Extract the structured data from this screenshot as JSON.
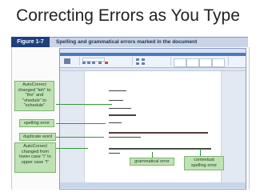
{
  "slide": {
    "title": "Correcting Errors as You Type"
  },
  "figure": {
    "number": "Figure 1-7",
    "caption": "Spelling and grammatical errors marked in the document"
  },
  "callouts": {
    "autocorrect_teh": "AutoCorrect changed \"teh\" to \"the\" and \"shedule\" to \"schedule\"",
    "spelling_error": "spelling error",
    "duplicate_word": "duplicate word",
    "autocorrect_case": "AutoCorrect changed from lower case \"i\" to upper case \"I\"",
    "grammatical_error": "grammatical error",
    "contextual_spelling": "contextual spelling error"
  },
  "colors": {
    "callout_fill": "#bfe2b4",
    "connector": "#2f9a3a",
    "figure_tag": "#1f3f7d",
    "spelling_underline": "#dd0000",
    "grammar_underline": "#2a8a2a"
  }
}
